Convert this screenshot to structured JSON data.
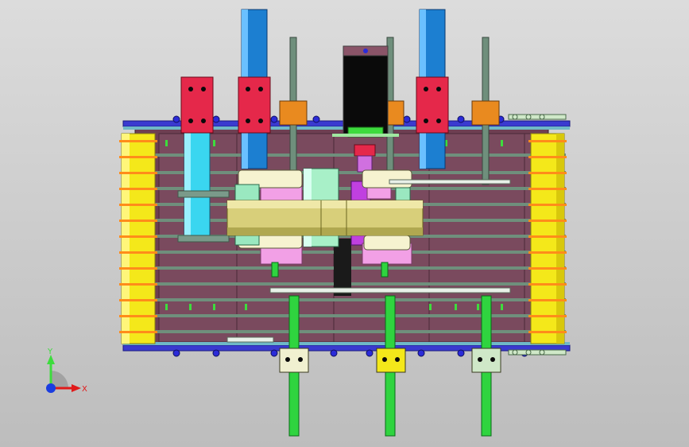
{
  "viewport": {
    "background_top": "#dcdcdc",
    "background_bottom": "#bdbdbd"
  },
  "triad": {
    "y_label": "Y",
    "x_label": "X",
    "y_color": "#3ddc3d",
    "x_color": "#e01a1a",
    "z_color": "#1a3de0"
  },
  "colors": {
    "frame_plate": "#6e3f52",
    "frame_plate_light": "#8a5468",
    "rail_blue": "#3a3ad0",
    "roller_yellow": "#f4e81a",
    "cylinder_blue": "#1c7fd1",
    "cylinder_cyan": "#3ad6f0",
    "shaft_green": "#2fd43f",
    "rod_gray": "#6f8f7c",
    "drum_olive": "#d8cf7a",
    "pink_block": "#f2a0e6",
    "clamp_red": "#e5284a",
    "clamp_orange": "#e98a1f",
    "housing_black": "#0a0a0a"
  }
}
